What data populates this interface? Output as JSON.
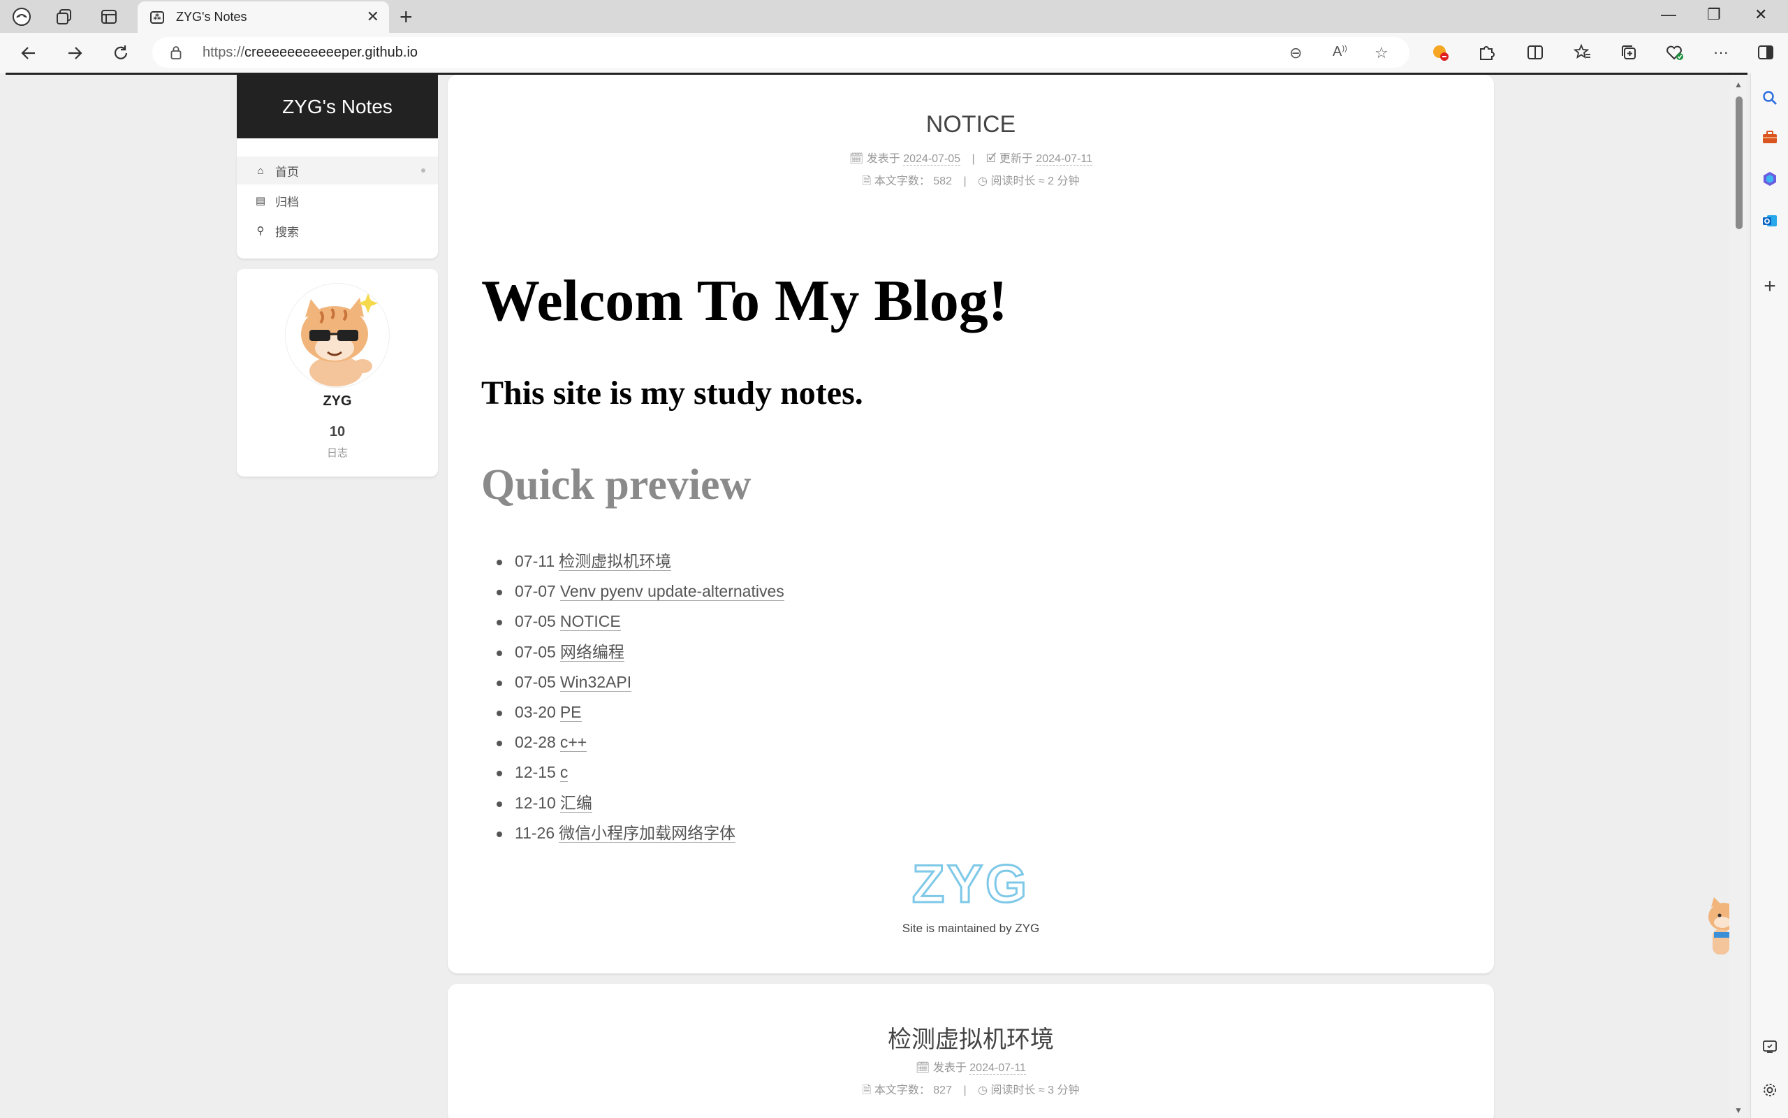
{
  "browser": {
    "tab_title": "ZYG's Notes",
    "tab_close": "✕",
    "new_tab": "+",
    "url_protocol": "https://",
    "url_host": "creeeeeeeeeeeper.github.io",
    "window_minimize": "—",
    "window_restore": "❐",
    "window_close": "✕",
    "more": "···"
  },
  "site": {
    "brand": "ZYG's Notes",
    "menu": [
      {
        "icon": "home-icon",
        "glyph": "⌂",
        "label": "首页"
      },
      {
        "icon": "archive-icon",
        "glyph": "▤",
        "label": "归档"
      },
      {
        "icon": "search-icon",
        "glyph": "⚲",
        "label": "搜索"
      }
    ],
    "author": {
      "name": "ZYG",
      "post_count": "10",
      "post_label": "日志"
    }
  },
  "post1": {
    "title": "NOTICE",
    "posted_label": "发表于",
    "posted_date": "2024-07-05",
    "updated_label": "更新于",
    "updated_date": "2024-07-11",
    "wordcount_label": "本文字数：",
    "wordcount": "582",
    "readtime_label": "阅读时长 ≈",
    "readtime": "2 分钟",
    "h1": "Welcom To My Blog!",
    "h2": "This site is my study notes.",
    "h3": "Quick preview",
    "preview": [
      {
        "date": "07-11",
        "title": "检测虚拟机环境"
      },
      {
        "date": "07-07",
        "title": "Venv pyenv update-alternatives"
      },
      {
        "date": "07-05",
        "title": "NOTICE"
      },
      {
        "date": "07-05",
        "title": "网络编程"
      },
      {
        "date": "07-05",
        "title": "Win32API"
      },
      {
        "date": "03-20",
        "title": "PE"
      },
      {
        "date": "02-28",
        "title": "c++"
      },
      {
        "date": "12-15",
        "title": "c"
      },
      {
        "date": "12-10",
        "title": "汇编"
      },
      {
        "date": "11-26",
        "title": "微信小程序加载网络字体"
      }
    ],
    "footer_logo_text": "ZYG",
    "footer_text": "Site is maintained by ZYG"
  },
  "post2": {
    "title": "检测虚拟机环境",
    "posted_label": "发表于",
    "posted_date": "2024-07-11",
    "wordcount_label": "本文字数：",
    "wordcount": "827",
    "readtime_label": "阅读时长 ≈",
    "readtime": "3 分钟"
  },
  "colors": {
    "brand_bg": "#222222",
    "page_bg": "#eeeeee",
    "logo_blue": "#7ec8e8"
  }
}
